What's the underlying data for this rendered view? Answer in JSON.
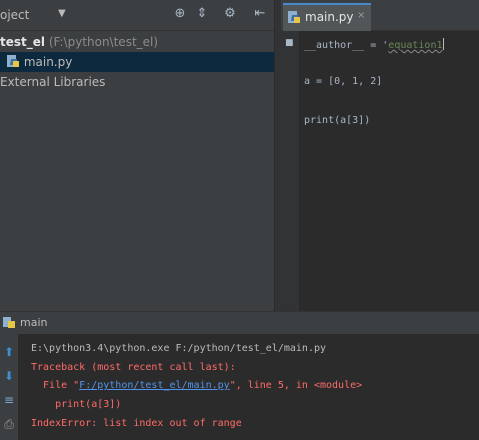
{
  "project_panel": {
    "title": "oject",
    "dropdown_arrow": "▼",
    "header_icons": [
      "target-icon",
      "collapse-icon",
      "gear-icon",
      "hide-icon"
    ],
    "tree": {
      "root_name": "test_el",
      "root_path": "(F:\\python\\test_el)",
      "file": "main.py",
      "libraries": "External Libraries"
    }
  },
  "editor": {
    "tab_label": "main.py",
    "tab_close": "×",
    "lines": {
      "l1_pre": "__author__ = '",
      "l1_str": "equation1",
      "l2": "a = [0, 1, 2]",
      "l3": "print(a[3])"
    }
  },
  "run_panel": {
    "title": "main",
    "console": {
      "cmd": "E:\\python3.4\\python.exe F:/python/test_el/main.py",
      "traceback": "Traceback (most recent call last):",
      "file_pre": "  File \"",
      "file_link": "F:/python/test_el/main.py",
      "file_post": "\", line 5, in <module>",
      "code": "    print(a[3])",
      "error": "IndexError: list index out of range"
    }
  },
  "colors": {
    "background": "#2b2b2b",
    "panel": "#3c3f41",
    "selection": "#0d293e",
    "error_text": "#ff6b68",
    "link": "#5394ec",
    "string": "#6a8759"
  }
}
